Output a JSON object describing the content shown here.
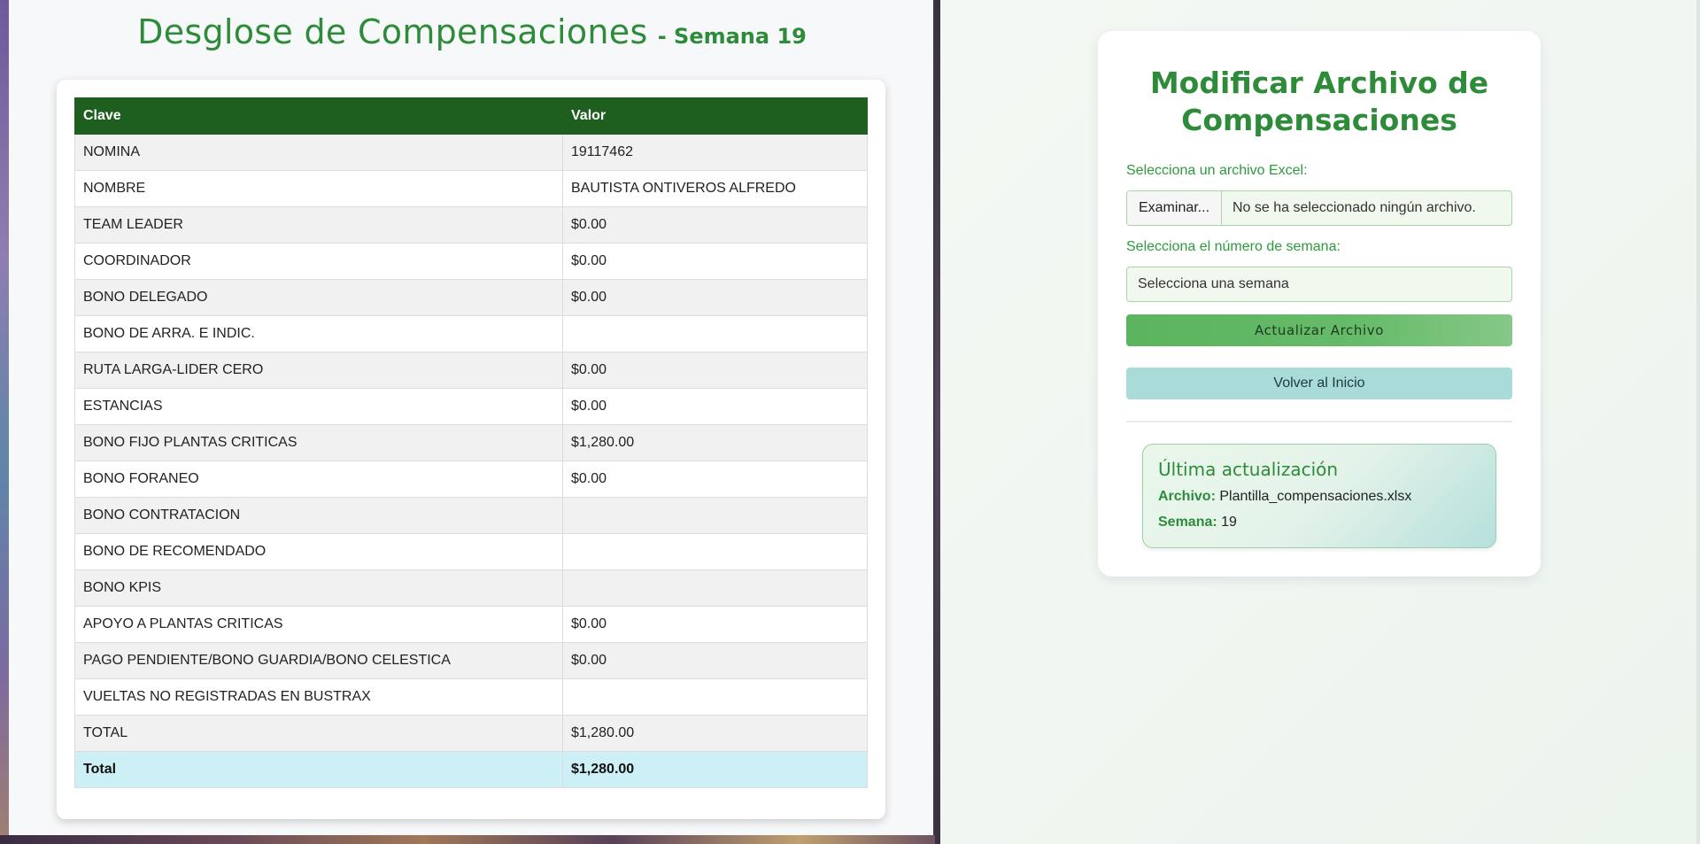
{
  "breakdown": {
    "title": "Desglose de Compensaciones",
    "week_label": "- Semana 19",
    "columns": [
      "Clave",
      "Valor"
    ],
    "rows": [
      {
        "key": "NOMINA",
        "value": "19117462"
      },
      {
        "key": "NOMBRE",
        "value": "BAUTISTA ONTIVEROS ALFREDO"
      },
      {
        "key": "TEAM LEADER",
        "value": "$0.00"
      },
      {
        "key": "COORDINADOR",
        "value": "$0.00"
      },
      {
        "key": "BONO DELEGADO",
        "value": "$0.00"
      },
      {
        "key": "BONO DE ARRA. E INDIC.",
        "value": ""
      },
      {
        "key": "RUTA LARGA-LIDER CERO",
        "value": "$0.00"
      },
      {
        "key": "ESTANCIAS",
        "value": "$0.00"
      },
      {
        "key": "BONO FIJO PLANTAS CRITICAS",
        "value": "$1,280.00"
      },
      {
        "key": "BONO FORANEO",
        "value": "$0.00"
      },
      {
        "key": "BONO CONTRATACION",
        "value": ""
      },
      {
        "key": "BONO DE RECOMENDADO",
        "value": ""
      },
      {
        "key": "BONO KPIS",
        "value": ""
      },
      {
        "key": "APOYO A PLANTAS CRITICAS",
        "value": "$0.00"
      },
      {
        "key": "PAGO PENDIENTE/BONO GUARDIA/BONO CELESTICA",
        "value": "$0.00"
      },
      {
        "key": "VUELTAS NO REGISTRADAS EN BUSTRAX",
        "value": ""
      },
      {
        "key": "TOTAL",
        "value": "$1,280.00"
      }
    ],
    "total": {
      "key": "Total",
      "value": "$1,280.00"
    }
  },
  "form": {
    "title": "Modificar Archivo de Compensaciones",
    "file_label": "Selecciona un archivo Excel:",
    "file_button": "Examinar...",
    "file_status": "No se ha seleccionado ningún archivo.",
    "week_label": "Selecciona el número de semana:",
    "week_selected": "Selecciona una semana",
    "update_button": "Actualizar Archivo",
    "home_button": "Volver al Inicio"
  },
  "last_update": {
    "title": "Última actualización",
    "file_key": "Archivo:",
    "file_value": "Plantilla_compensaciones.xlsx",
    "week_key": "Semana:",
    "week_value": "19"
  },
  "colors": {
    "accent_green": "#2e8b3a",
    "table_header": "#1e5e1e",
    "total_row": "#cdeff6",
    "home_button": "#a9dcd8"
  }
}
